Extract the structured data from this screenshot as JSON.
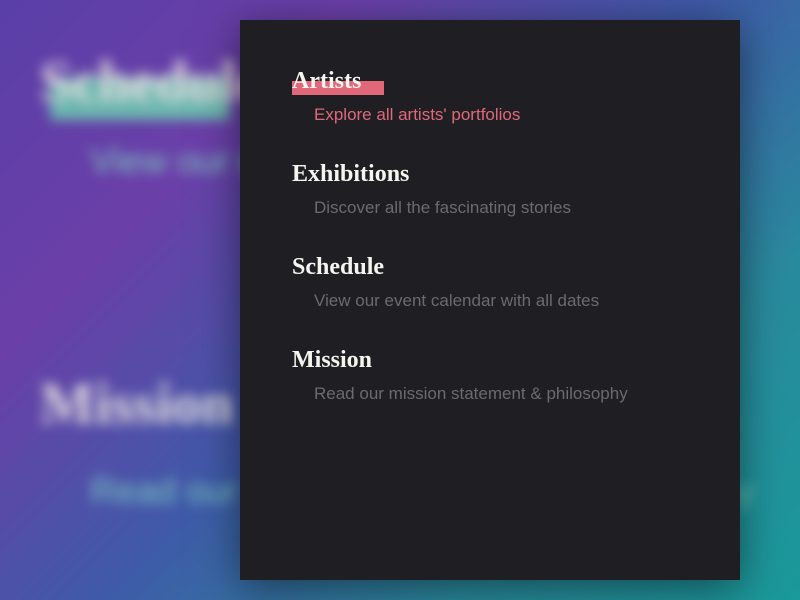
{
  "menu": {
    "items": [
      {
        "title": "Artists",
        "subtitle": "Explore all artists' portfolios",
        "active": true
      },
      {
        "title": "Exhibitions",
        "subtitle": "Discover all the fascinating stories",
        "active": false
      },
      {
        "title": "Schedule",
        "subtitle": "View our event calendar with all dates",
        "active": false
      },
      {
        "title": "Mission",
        "subtitle": "Read our mission statement & philosophy",
        "active": false
      }
    ]
  },
  "background": {
    "items": [
      {
        "title": "Schedule",
        "subtitle": "View our event calendar with all dates"
      },
      {
        "title": "Mission",
        "subtitle": "Read our mission statement & philosophy"
      }
    ]
  },
  "colors": {
    "panel_bg": "#1f1f23",
    "accent": "#e06878",
    "title": "#f5f5f0",
    "muted": "#6a6a70",
    "bg_highlight": "#6cc4b0"
  }
}
